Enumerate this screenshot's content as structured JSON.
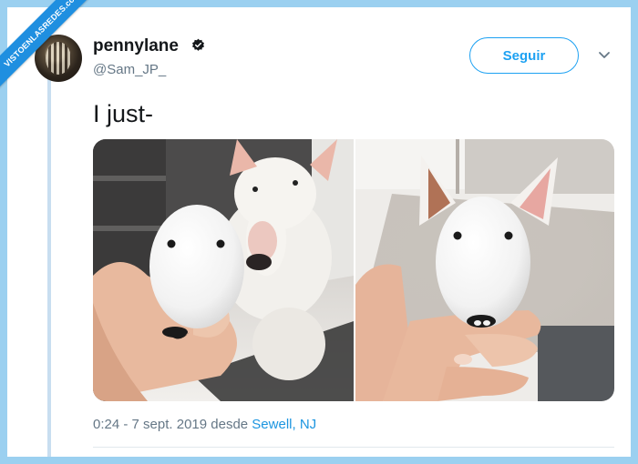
{
  "banner": {
    "text": "VISTOENLASREDES",
    "subtext": ".com"
  },
  "user": {
    "display_name": "pennylane",
    "handle": "@Sam_JP_",
    "verified_icon": "verified-badge-icon"
  },
  "actions": {
    "follow_label": "Seguir",
    "menu_icon": "chevron-down-icon"
  },
  "tweet": {
    "text": "I just-"
  },
  "media": {
    "photos": [
      {
        "description_icon": "photo-egg-vs-dog-left"
      },
      {
        "description_icon": "photo-egg-vs-dog-right"
      }
    ]
  },
  "meta": {
    "time_date": "0:24 - 7 sept. 2019 desde ",
    "location": "Sewell, NJ"
  },
  "colors": {
    "accent": "#1da1f2",
    "link": "#1b95e0",
    "muted": "#657786",
    "frame": "#9bd0f0"
  }
}
